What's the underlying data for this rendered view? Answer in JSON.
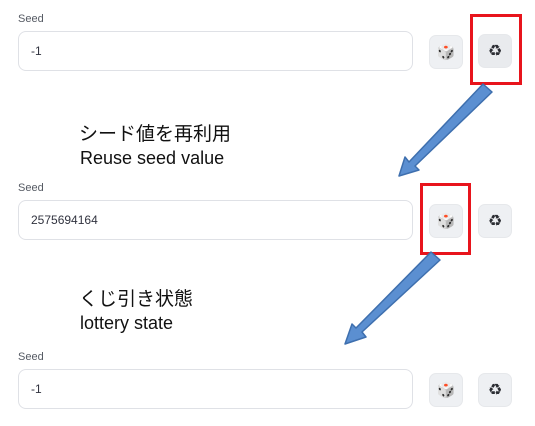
{
  "groups": [
    {
      "label": "Seed",
      "value": "-1"
    },
    {
      "label": "Seed",
      "value": "2575694164"
    },
    {
      "label": "Seed",
      "value": "-1"
    }
  ],
  "buttons": {
    "dice_glyph": "🎲",
    "recycle_glyph": "♻",
    "dice_icon": "dice-icon",
    "recycle_icon": "recycle-icon"
  },
  "annotations": [
    {
      "jp": "シード値を再利用",
      "en": "Reuse seed value"
    },
    {
      "jp": "くじ引き状態",
      "en": "lottery state"
    }
  ],
  "colors": {
    "highlight": "#e8141c",
    "arrow_fill": "#5b8fd1",
    "arrow_stroke": "#3e6fae"
  }
}
